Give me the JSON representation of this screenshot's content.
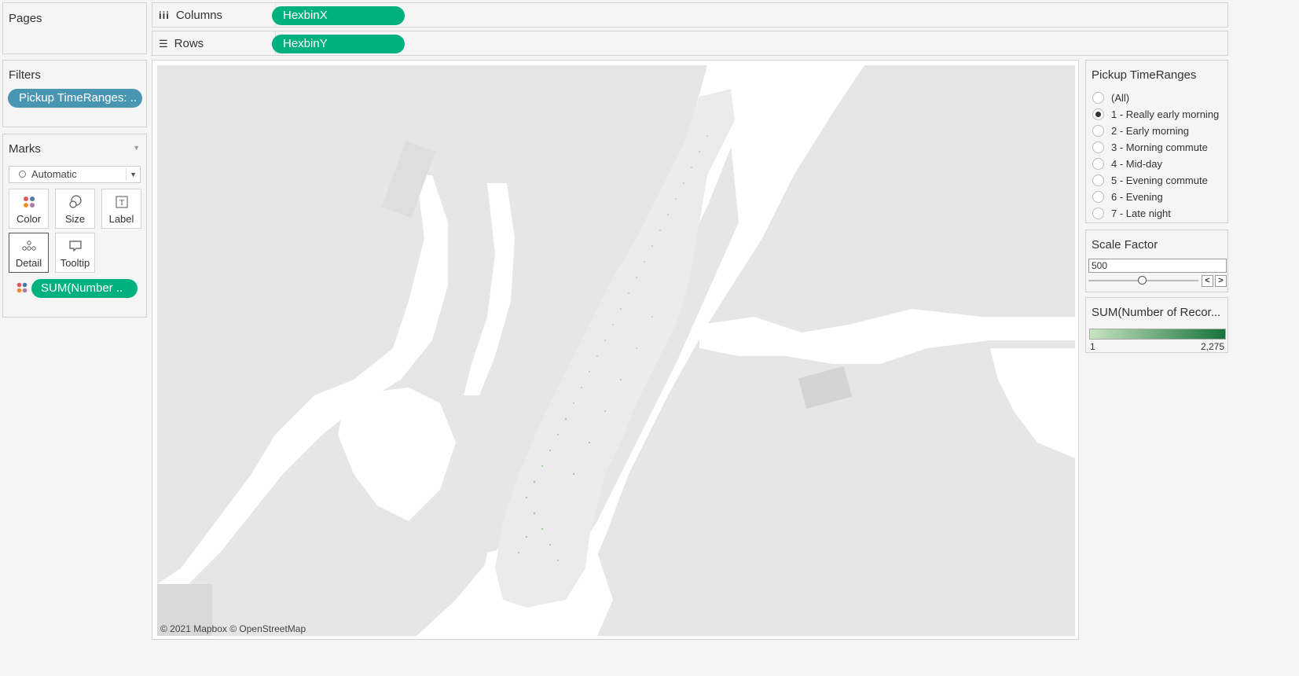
{
  "pages": {
    "title": "Pages"
  },
  "columns_shelf": {
    "label": "Columns",
    "pill": "HexbinX"
  },
  "rows_shelf": {
    "label": "Rows",
    "pill": "HexbinY"
  },
  "filters": {
    "title": "Filters",
    "pill": "Pickup TimeRanges: .."
  },
  "marks": {
    "title": "Marks",
    "mark_type": "Automatic",
    "cards": [
      {
        "label": "Color",
        "icon": "color-dots-icon"
      },
      {
        "label": "Size",
        "icon": "size-circles-icon"
      },
      {
        "label": "Label",
        "icon": "label-t-icon"
      },
      {
        "label": "Detail",
        "icon": "detail-dots-icon"
      },
      {
        "label": "Tooltip",
        "icon": "tooltip-bubble-icon"
      }
    ],
    "field_pill": "SUM(Number .."
  },
  "map": {
    "attribution": "© 2021 Mapbox © OpenStreetMap"
  },
  "time_filter": {
    "title": "Pickup TimeRanges",
    "options": [
      {
        "label": "(All)",
        "checked": false
      },
      {
        "label": "1 - Really early morning",
        "checked": true
      },
      {
        "label": "2 - Early morning",
        "checked": false
      },
      {
        "label": "3 - Morning commute",
        "checked": false
      },
      {
        "label": "4 - Mid-day",
        "checked": false
      },
      {
        "label": "5 - Evening commute",
        "checked": false
      },
      {
        "label": "6 - Evening",
        "checked": false
      },
      {
        "label": "7 - Late night",
        "checked": false
      }
    ]
  },
  "scale_factor": {
    "title": "Scale Factor",
    "value": "500"
  },
  "legend": {
    "title": "SUM(Number of Recor...",
    "min_label": "1",
    "max_label": "2,275",
    "color_start": "#c9e4c0",
    "color_end": "#16733a"
  },
  "colors": {
    "pill_green": "#00b180",
    "pill_blue": "#4996b2"
  }
}
